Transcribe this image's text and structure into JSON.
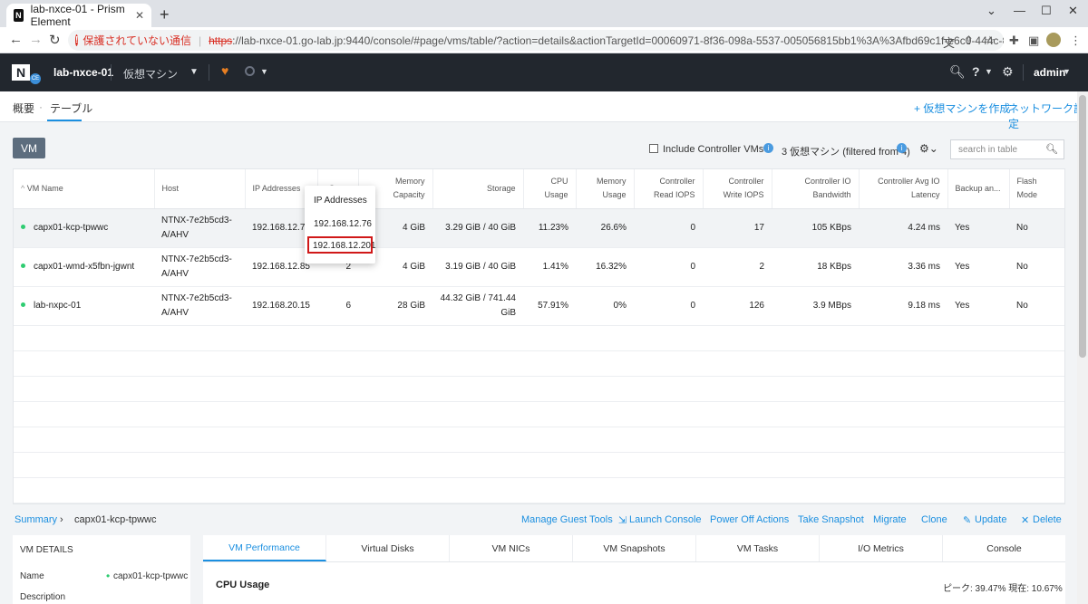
{
  "browser": {
    "tab_title": "lab-nxce-01 - Prism Element",
    "security_warning": "保護されていない通信",
    "url_scheme": "https",
    "url_rest": "://lab-nxce-01.go-lab.jp:9440/console/#page/vms/table/?action=details&actionTargetId=00060971-8f36-098a-5537-005056815bb1%3A%3Afbd69c1f-e6c0-444c-8548-3da382ddd4ec&action..."
  },
  "header": {
    "cluster_name": "lab-nxce-01",
    "menu": "仮想マシン",
    "user": "admin"
  },
  "subnav": {
    "overview": "概要",
    "table": "テーブル",
    "create_vm": "+ 仮想マシンを作成",
    "network_config": "ネットワーク設定"
  },
  "toolbar": {
    "vm_button": "VM",
    "include_controller": "Include Controller VMs",
    "count_text": "3 仮想マシン (filtered from 4)",
    "search_placeholder": "search in table"
  },
  "table": {
    "columns": [
      "VM Name",
      "Host",
      "IP Addresses",
      "Cores",
      "Memory Capacity",
      "Storage",
      "CPU Usage",
      "Memory Usage",
      "Controller Read IOPS",
      "Controller Write IOPS",
      "Controller IO Bandwidth",
      "Controller Avg IO Latency",
      "Backup an...",
      "Flash Mode"
    ],
    "rows": [
      {
        "name": "capx01-kcp-tpwwc",
        "host": "NTNX-7e2b5cd3-A/AHV",
        "ip": "192.168.12.76",
        "cores": "",
        "memory": "4 GiB",
        "storage": "3.29 GiB / 40 GiB",
        "cpu": "11.23%",
        "mem_usage": "26.6%",
        "read_iops": "0",
        "write_iops": "17",
        "bandwidth": "105 KBps",
        "latency": "4.24 ms",
        "backup": "Yes",
        "flash": "No"
      },
      {
        "name": "capx01-wmd-x5fbn-jgwnt",
        "host": "NTNX-7e2b5cd3-A/AHV",
        "ip": "192.168.12.85",
        "cores": "2",
        "memory": "4 GiB",
        "storage": "3.19 GiB / 40 GiB",
        "cpu": "1.41%",
        "mem_usage": "16.32%",
        "read_iops": "0",
        "write_iops": "2",
        "bandwidth": "18 KBps",
        "latency": "3.36 ms",
        "backup": "Yes",
        "flash": "No"
      },
      {
        "name": "lab-nxpc-01",
        "host": "NTNX-7e2b5cd3-A/AHV",
        "ip": "192.168.20.15",
        "cores": "6",
        "memory": "28 GiB",
        "storage": "44.32 GiB / 741.44 GiB",
        "cpu": "57.91%",
        "mem_usage": "0%",
        "read_iops": "0",
        "write_iops": "126",
        "bandwidth": "3.9 MBps",
        "latency": "9.18 ms",
        "backup": "Yes",
        "flash": "No"
      }
    ]
  },
  "ip_popup": {
    "title": "IP Addresses",
    "ips": [
      "192.168.12.76",
      "192.168.12.201"
    ]
  },
  "summary": {
    "summary_link": "Summary",
    "selected_vm": "capx01-kcp-tpwwc",
    "actions": [
      "Manage Guest Tools",
      "Launch Console",
      "Power Off Actions",
      "Take Snapshot",
      "Migrate",
      "Clone",
      "Update",
      "Delete"
    ]
  },
  "details": {
    "title": "VM DETAILS",
    "name_label": "Name",
    "name_value": "capx01-kcp-tpwwc",
    "description_label": "Description"
  },
  "perf": {
    "tabs": [
      "VM Performance",
      "Virtual Disks",
      "VM NICs",
      "VM Snapshots",
      "VM Tasks",
      "I/O Metrics",
      "Console"
    ],
    "cpu_title": "CPU Usage",
    "peak_text": "ピーク: 39.47%   現在: 10.67%"
  },
  "colors": {
    "accent": "#1b8fe0",
    "header_bg": "#22272e",
    "highlight": "#d01818"
  }
}
